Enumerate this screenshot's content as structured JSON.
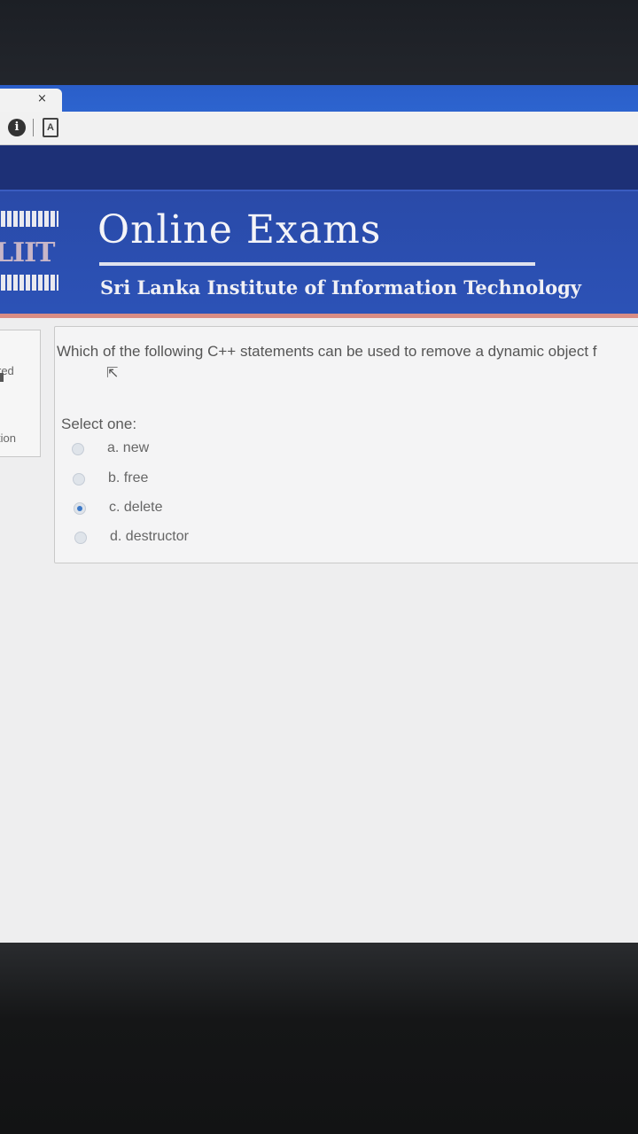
{
  "browser": {
    "tab_close": "×",
    "info_icon": "i",
    "page_icon": "A"
  },
  "site": {
    "logo_text": "LIIT",
    "title": "Online Exams",
    "subtitle": "Sri Lanka Institute of Information Technology"
  },
  "sidebar": {
    "items": [
      {
        "label": "red"
      },
      {
        "label": "tion"
      }
    ]
  },
  "question": {
    "text": "Which of the following C++ statements can be used to remove a dynamic object f",
    "select_label": "Select one:",
    "options": [
      {
        "label": "a. new",
        "checked": false
      },
      {
        "label": "b. free",
        "checked": false
      },
      {
        "label": "c. delete",
        "checked": true
      },
      {
        "label": "d. destructor",
        "checked": false
      }
    ]
  },
  "colors": {
    "header_blue": "#2b4fb1",
    "nav_navy": "#1d3076",
    "tab_blue": "#2d64cf",
    "radio_selected": "#3b78c8"
  }
}
